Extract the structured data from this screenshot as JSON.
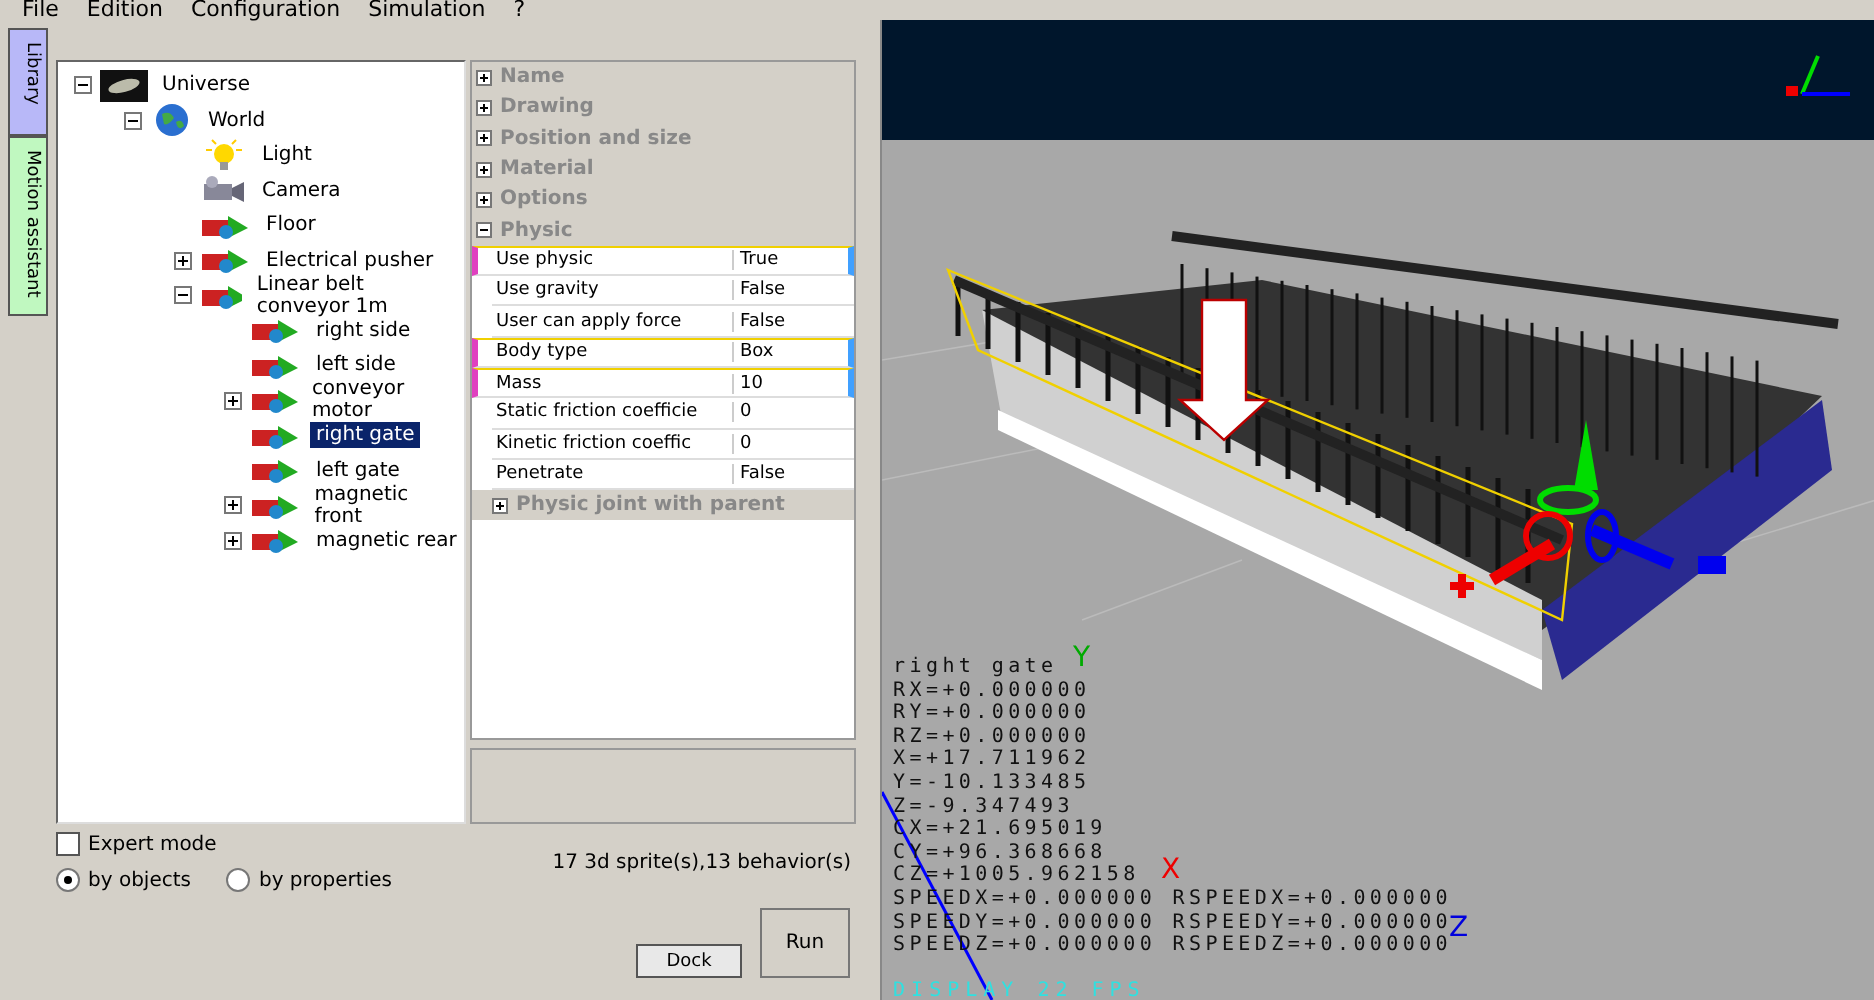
{
  "menu": [
    "File",
    "Edition",
    "Configuration",
    "Simulation",
    "?"
  ],
  "side_tabs": [
    {
      "label": "Library",
      "color": "#b8b8f8"
    },
    {
      "label": "Motion assistant",
      "color": "#c0f8c0"
    }
  ],
  "tree": [
    {
      "label": "Universe",
      "kind": "galaxy",
      "expanded": true,
      "selected": false,
      "children": [
        {
          "label": "World",
          "kind": "globe",
          "expanded": true,
          "selected": false,
          "children": [
            {
              "label": "Light",
              "kind": "bulb",
              "selected": false
            },
            {
              "label": "Camera",
              "kind": "camera",
              "selected": false
            },
            {
              "label": "Floor",
              "kind": "object",
              "selected": false
            },
            {
              "label": "Electrical pusher",
              "kind": "object",
              "expanded": false,
              "selected": false
            },
            {
              "label": "Linear belt conveyor 1m",
              "kind": "object",
              "expanded": true,
              "selected": false,
              "children": [
                {
                  "label": "right side",
                  "kind": "object",
                  "selected": false
                },
                {
                  "label": "left side",
                  "kind": "object",
                  "selected": false
                },
                {
                  "label": "conveyor motor",
                  "kind": "object",
                  "expanded": false,
                  "selected": false
                },
                {
                  "label": "right gate",
                  "kind": "object",
                  "selected": true
                },
                {
                  "label": "left gate",
                  "kind": "object",
                  "selected": false
                },
                {
                  "label": "magnetic front",
                  "kind": "object",
                  "expanded": false,
                  "selected": false
                },
                {
                  "label": "magnetic rear",
                  "kind": "object",
                  "expanded": false,
                  "selected": false
                }
              ]
            }
          ]
        }
      ]
    }
  ],
  "properties": [
    {
      "name": "Name",
      "expanded": false
    },
    {
      "name": "Drawing",
      "expanded": false
    },
    {
      "name": "Position and size",
      "expanded": false
    },
    {
      "name": "Material",
      "expanded": false
    },
    {
      "name": "Options",
      "expanded": false
    },
    {
      "name": "Physic",
      "expanded": true,
      "rows": [
        {
          "name": "Use physic",
          "value": "True",
          "highlighted": true
        },
        {
          "name": "Use gravity",
          "value": "False",
          "highlighted": false
        },
        {
          "name": "User can apply force",
          "value": "False",
          "highlighted": false
        },
        {
          "name": "Body type",
          "value": "Box",
          "highlighted": true
        },
        {
          "name": "Mass",
          "value": "10",
          "highlighted": true
        },
        {
          "name": "Static friction coefficie",
          "value": "0",
          "highlighted": false
        },
        {
          "name": "Kinetic friction coeffic",
          "value": "0",
          "highlighted": false
        },
        {
          "name": "Penetrate",
          "value": "False",
          "highlighted": false
        }
      ],
      "subgroup": {
        "name": "Physic joint with parent",
        "expanded": false
      }
    }
  ],
  "expert_mode": {
    "label": "Expert mode",
    "checked": false
  },
  "view_modes": [
    {
      "label": "by objects",
      "selected": true
    },
    {
      "label": "by properties",
      "selected": false
    }
  ],
  "status": "17 3d sprite(s),13 behavior(s)",
  "buttons": {
    "dock": "Dock",
    "run": "Run"
  },
  "viewport": {
    "readout": [
      "right gate",
      "RX=+0.000000",
      "RY=+0.000000",
      "RZ=+0.000000",
      "X=+17.711962",
      "Y=-10.133485",
      "Z=-9.347493",
      "CX=+21.695019",
      "CY=+96.368668",
      "CZ=+1005.962158",
      "SPEEDX=+0.000000 RSPEEDX=+0.000000",
      "SPEEDY=+0.000000 RSPEEDY=+0.000000",
      "SPEEDZ=+0.000000 RSPEEDZ=+0.000000"
    ],
    "fps": "DISPLAY 22 FPS",
    "gizmo_labels": [
      "Y",
      "X",
      "Z"
    ]
  }
}
